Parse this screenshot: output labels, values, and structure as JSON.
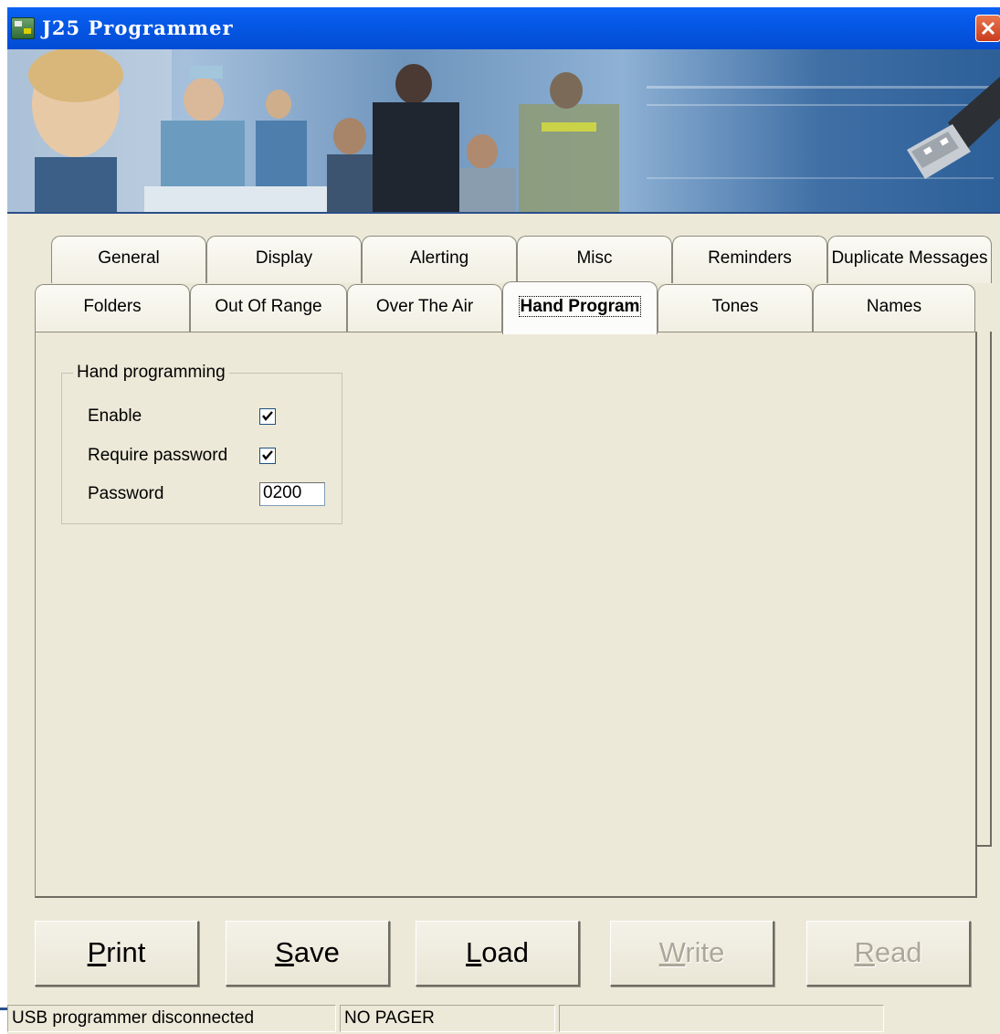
{
  "window": {
    "title": "J25 Programmer"
  },
  "tabs": {
    "row1": [
      "General",
      "Display",
      "Alerting",
      "Misc",
      "Reminders",
      "Duplicate Messages"
    ],
    "row2": [
      "Folders",
      "Out Of Range",
      "Over The Air",
      "Hand Program",
      "Tones",
      "Names"
    ],
    "active": "Hand Program"
  },
  "hand_program": {
    "group_title": "Hand programming",
    "enable_label": "Enable",
    "enable_checked": true,
    "require_password_label": "Require password",
    "require_password_checked": true,
    "password_label": "Password",
    "password_value": "0200"
  },
  "buttons": {
    "print": {
      "access_key": "P",
      "rest": "rint",
      "enabled": true
    },
    "save": {
      "access_key": "S",
      "rest": "ave",
      "enabled": true
    },
    "load": {
      "access_key": "L",
      "rest": "oad",
      "enabled": true
    },
    "write": {
      "access_key": "W",
      "rest": "rite",
      "enabled": false
    },
    "read": {
      "access_key": "R",
      "rest": "ead",
      "enabled": false
    }
  },
  "status": {
    "connection": "USB programmer disconnected",
    "pager": "NO PAGER",
    "extra": ""
  },
  "icons": {
    "app": "app-icon",
    "close": "close-icon",
    "check": "checkmark-icon"
  },
  "colors": {
    "titlebar": "#0558e6",
    "close": "#d64a26",
    "face": "#ece9d8"
  }
}
